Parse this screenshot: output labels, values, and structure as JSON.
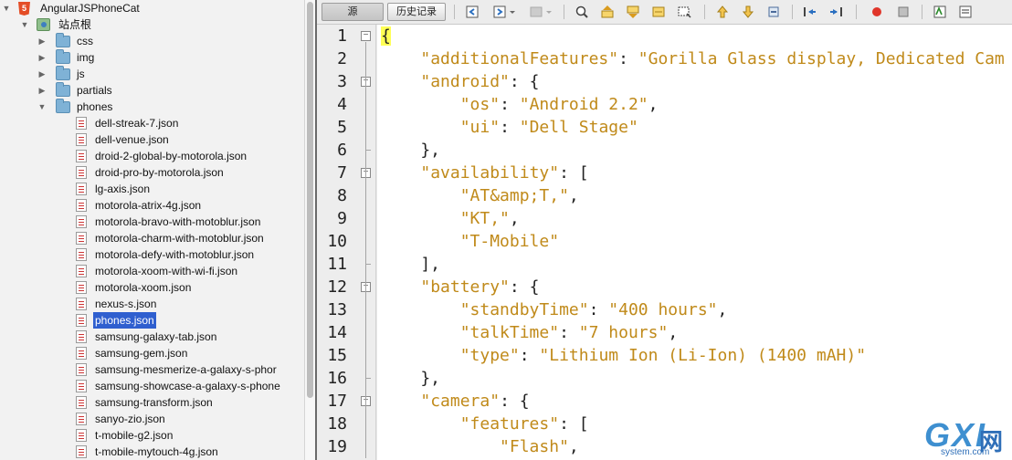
{
  "tree": {
    "project": "AngularJSPhoneCat",
    "site_root": "站点根",
    "folders": [
      "css",
      "img",
      "js",
      "partials",
      "phones"
    ],
    "files": [
      "dell-streak-7.json",
      "dell-venue.json",
      "droid-2-global-by-motorola.json",
      "droid-pro-by-motorola.json",
      "lg-axis.json",
      "motorola-atrix-4g.json",
      "motorola-bravo-with-motoblur.json",
      "motorola-charm-with-motoblur.json",
      "motorola-defy-with-motoblur.json",
      "motorola-xoom-with-wi-fi.json",
      "motorola-xoom.json",
      "nexus-s.json",
      "phones.json",
      "samsung-galaxy-tab.json",
      "samsung-gem.json",
      "samsung-mesmerize-a-galaxy-s-phor",
      "samsung-showcase-a-galaxy-s-phone",
      "samsung-transform.json",
      "sanyo-zio.json",
      "t-mobile-g2.json",
      "t-mobile-mytouch-4g.json"
    ],
    "selected_file": "phones.json"
  },
  "toolbar": {
    "source_label": "源",
    "history_label": "历史记录"
  },
  "editor": {
    "line_numbers": [
      "1",
      "2",
      "3",
      "4",
      "5",
      "6",
      "7",
      "8",
      "9",
      "10",
      "11",
      "12",
      "13",
      "14",
      "15",
      "16",
      "17",
      "18",
      "19"
    ],
    "code": [
      [
        {
          "t": "{",
          "c": "brace"
        }
      ],
      [
        {
          "t": "    ",
          "c": "p"
        },
        {
          "t": "\"additionalFeatures\"",
          "c": "k"
        },
        {
          "t": ": ",
          "c": "p"
        },
        {
          "t": "\"Gorilla Glass display, Dedicated Cam",
          "c": "s"
        }
      ],
      [
        {
          "t": "    ",
          "c": "p"
        },
        {
          "t": "\"android\"",
          "c": "k"
        },
        {
          "t": ": {",
          "c": "p"
        }
      ],
      [
        {
          "t": "        ",
          "c": "p"
        },
        {
          "t": "\"os\"",
          "c": "k"
        },
        {
          "t": ": ",
          "c": "p"
        },
        {
          "t": "\"Android 2.2\"",
          "c": "s"
        },
        {
          "t": ",",
          "c": "p"
        }
      ],
      [
        {
          "t": "        ",
          "c": "p"
        },
        {
          "t": "\"ui\"",
          "c": "k"
        },
        {
          "t": ": ",
          "c": "p"
        },
        {
          "t": "\"Dell Stage\"",
          "c": "s"
        }
      ],
      [
        {
          "t": "    },",
          "c": "p"
        }
      ],
      [
        {
          "t": "    ",
          "c": "p"
        },
        {
          "t": "\"availability\"",
          "c": "k"
        },
        {
          "t": ": [",
          "c": "p"
        }
      ],
      [
        {
          "t": "        ",
          "c": "p"
        },
        {
          "t": "\"AT&amp;T,\"",
          "c": "s"
        },
        {
          "t": ",",
          "c": "p"
        }
      ],
      [
        {
          "t": "        ",
          "c": "p"
        },
        {
          "t": "\"KT,\"",
          "c": "s"
        },
        {
          "t": ",",
          "c": "p"
        }
      ],
      [
        {
          "t": "        ",
          "c": "p"
        },
        {
          "t": "\"T-Mobile\"",
          "c": "s"
        }
      ],
      [
        {
          "t": "    ],",
          "c": "p"
        }
      ],
      [
        {
          "t": "    ",
          "c": "p"
        },
        {
          "t": "\"battery\"",
          "c": "k"
        },
        {
          "t": ": {",
          "c": "p"
        }
      ],
      [
        {
          "t": "        ",
          "c": "p"
        },
        {
          "t": "\"standbyTime\"",
          "c": "k"
        },
        {
          "t": ": ",
          "c": "p"
        },
        {
          "t": "\"400 hours\"",
          "c": "s"
        },
        {
          "t": ",",
          "c": "p"
        }
      ],
      [
        {
          "t": "        ",
          "c": "p"
        },
        {
          "t": "\"talkTime\"",
          "c": "k"
        },
        {
          "t": ": ",
          "c": "p"
        },
        {
          "t": "\"7 hours\"",
          "c": "s"
        },
        {
          "t": ",",
          "c": "p"
        }
      ],
      [
        {
          "t": "        ",
          "c": "p"
        },
        {
          "t": "\"type\"",
          "c": "k"
        },
        {
          "t": ": ",
          "c": "p"
        },
        {
          "t": "\"Lithium Ion (Li-Ion) (1400 mAH)\"",
          "c": "s"
        }
      ],
      [
        {
          "t": "    },",
          "c": "p"
        }
      ],
      [
        {
          "t": "    ",
          "c": "p"
        },
        {
          "t": "\"camera\"",
          "c": "k"
        },
        {
          "t": ": {",
          "c": "p"
        }
      ],
      [
        {
          "t": "        ",
          "c": "p"
        },
        {
          "t": "\"features\"",
          "c": "k"
        },
        {
          "t": ": [",
          "c": "p"
        }
      ],
      [
        {
          "t": "            ",
          "c": "p"
        },
        {
          "t": "\"Flash\"",
          "c": "s"
        },
        {
          "t": ",",
          "c": "p"
        }
      ]
    ],
    "fold_lines": [
      "1",
      "3",
      "7",
      "12",
      "17"
    ],
    "colors": {
      "key": "#c08a1a",
      "string": "#c08a1a",
      "brace_highlight": "#ffff55"
    }
  },
  "watermark": {
    "logo": "GXI",
    "cn": "网",
    "site": "system.com"
  }
}
